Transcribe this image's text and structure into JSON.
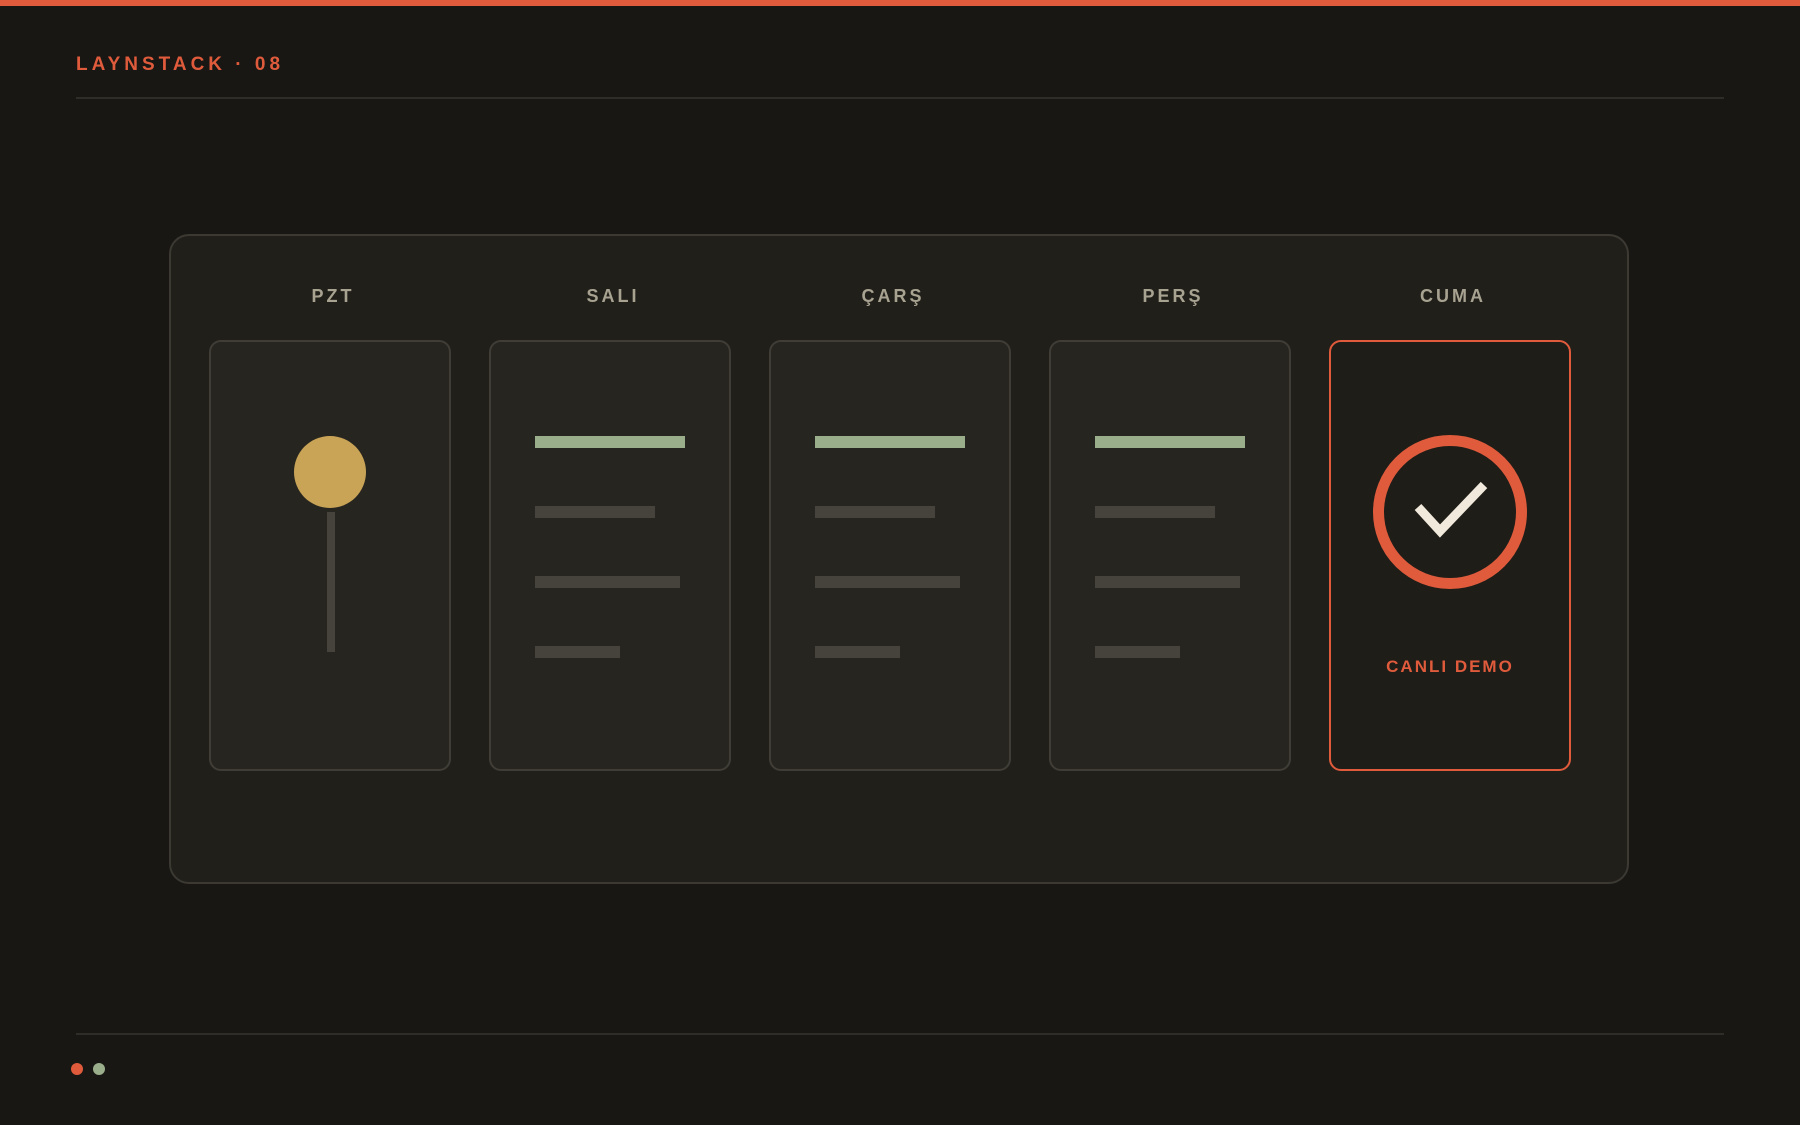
{
  "header": {
    "brand": "LAYNSTACK · 08"
  },
  "board": {
    "days": [
      {
        "label": "PZT",
        "kind": "pin"
      },
      {
        "label": "SALI",
        "kind": "list"
      },
      {
        "label": "ÇARŞ",
        "kind": "list"
      },
      {
        "label": "PERŞ",
        "kind": "list"
      },
      {
        "label": "CUMA",
        "kind": "done",
        "caption": "CANLI DEMO"
      }
    ]
  },
  "colors": {
    "accent": "#df5b3c",
    "pin": "#c9a457",
    "highlight": "#9aae8c",
    "muted": "#45433b",
    "check": "#f1e9dc"
  },
  "pagination": {
    "dots": [
      "#df5b3c",
      "#9aae8c"
    ]
  }
}
